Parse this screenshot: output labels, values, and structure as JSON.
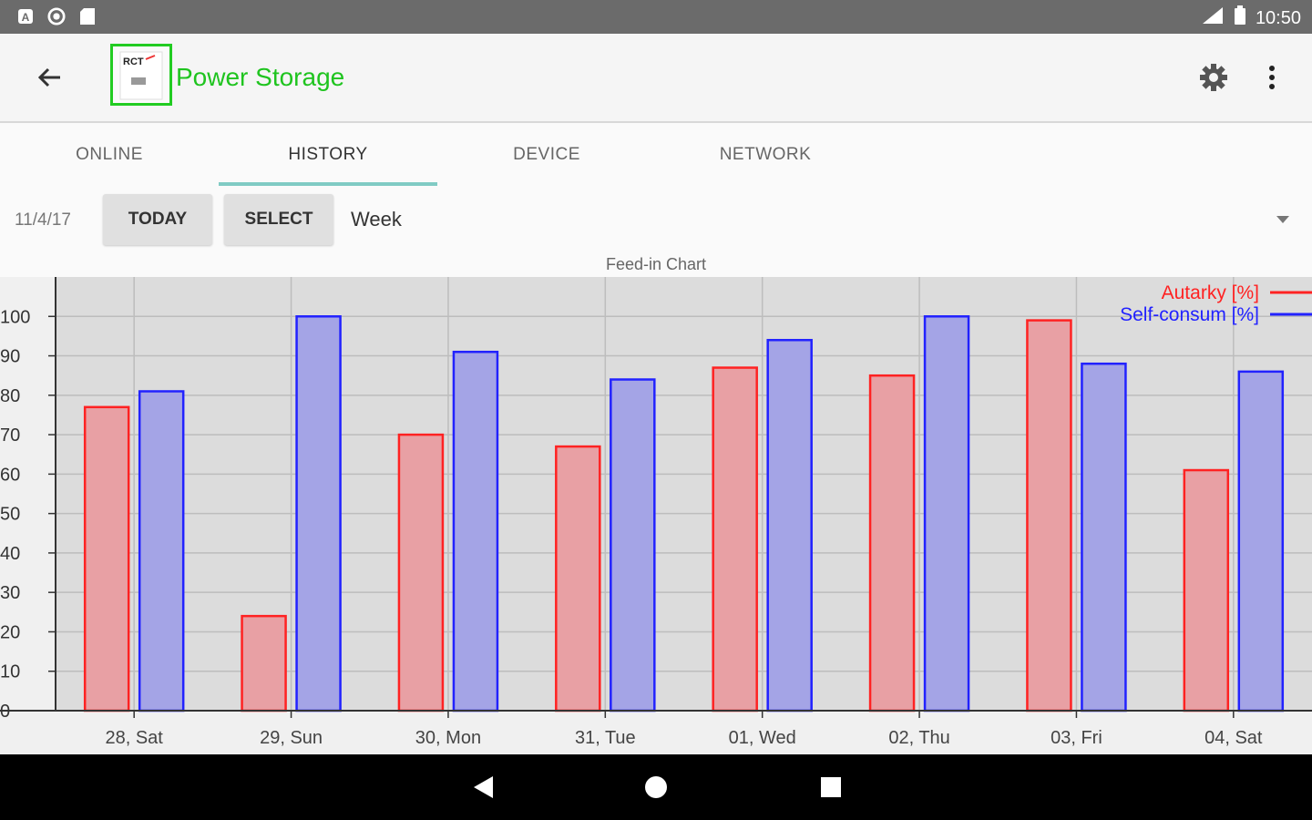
{
  "status_bar": {
    "time": "10:50",
    "left_icons": [
      "notification-a-icon",
      "circle-icon",
      "sd-card-icon"
    ],
    "right_icons": [
      "signal-icon",
      "battery-icon"
    ]
  },
  "app_bar": {
    "logo_text": "RCT",
    "title": "Power Storage",
    "title_color": "#1fc41f",
    "logo_border_color": "#22cc22"
  },
  "tabs": [
    {
      "label": "ONLINE",
      "active": false
    },
    {
      "label": "HISTORY",
      "active": true
    },
    {
      "label": "DEVICE",
      "active": false
    },
    {
      "label": "NETWORK",
      "active": false
    }
  ],
  "controls": {
    "date": "11/4/17",
    "today_label": "TODAY",
    "select_label": "SELECT",
    "period_value": "Week"
  },
  "chart_title": "Feed-in Chart",
  "chart_data": {
    "type": "bar",
    "title": "Feed-in Chart",
    "categories": [
      "28, Sat",
      "29, Sun",
      "30, Mon",
      "31, Tue",
      "01, Wed",
      "02, Thu",
      "03, Fri",
      "04, Sat"
    ],
    "series": [
      {
        "name": "Autarky [%]",
        "color": "#ff2222",
        "fill": "#e8a0a4",
        "values": [
          77,
          24,
          70,
          67,
          87,
          85,
          99,
          61
        ]
      },
      {
        "name": "Self-consum [%]",
        "color": "#2222ff",
        "fill": "#a4a4e6",
        "values": [
          81,
          100,
          91,
          84,
          94,
          100,
          88,
          86
        ]
      }
    ],
    "y_ticks": [
      0,
      10,
      20,
      30,
      40,
      50,
      60,
      70,
      80,
      90,
      100
    ],
    "ylim": [
      0,
      110
    ],
    "grid": true,
    "legend_position": "top-right"
  },
  "nav_bar": {
    "buttons": [
      "back-triangle-icon",
      "home-circle-icon",
      "recents-square-icon"
    ]
  }
}
